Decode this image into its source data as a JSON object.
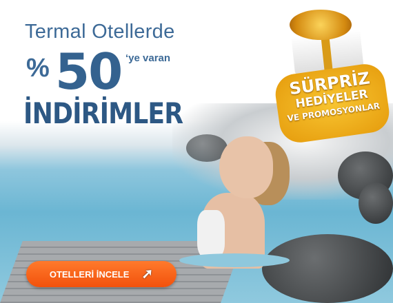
{
  "headline": {
    "line1": "Termal Otellerde",
    "percent_sign": "%",
    "discount": "50",
    "suffix": "‘ye varan",
    "line3": "İNDİRİMLER"
  },
  "badge": {
    "line1": "SÜRPRİZ",
    "line2": "HEDİYELER",
    "line3": "VE PROMOSYONLAR"
  },
  "cta": {
    "label": "OTELLERİ İNCELE",
    "icon": "cursor-icon"
  },
  "colors": {
    "headline": "#3d6a97",
    "cta": "#f2510c",
    "badge": "#f0ad1a"
  }
}
